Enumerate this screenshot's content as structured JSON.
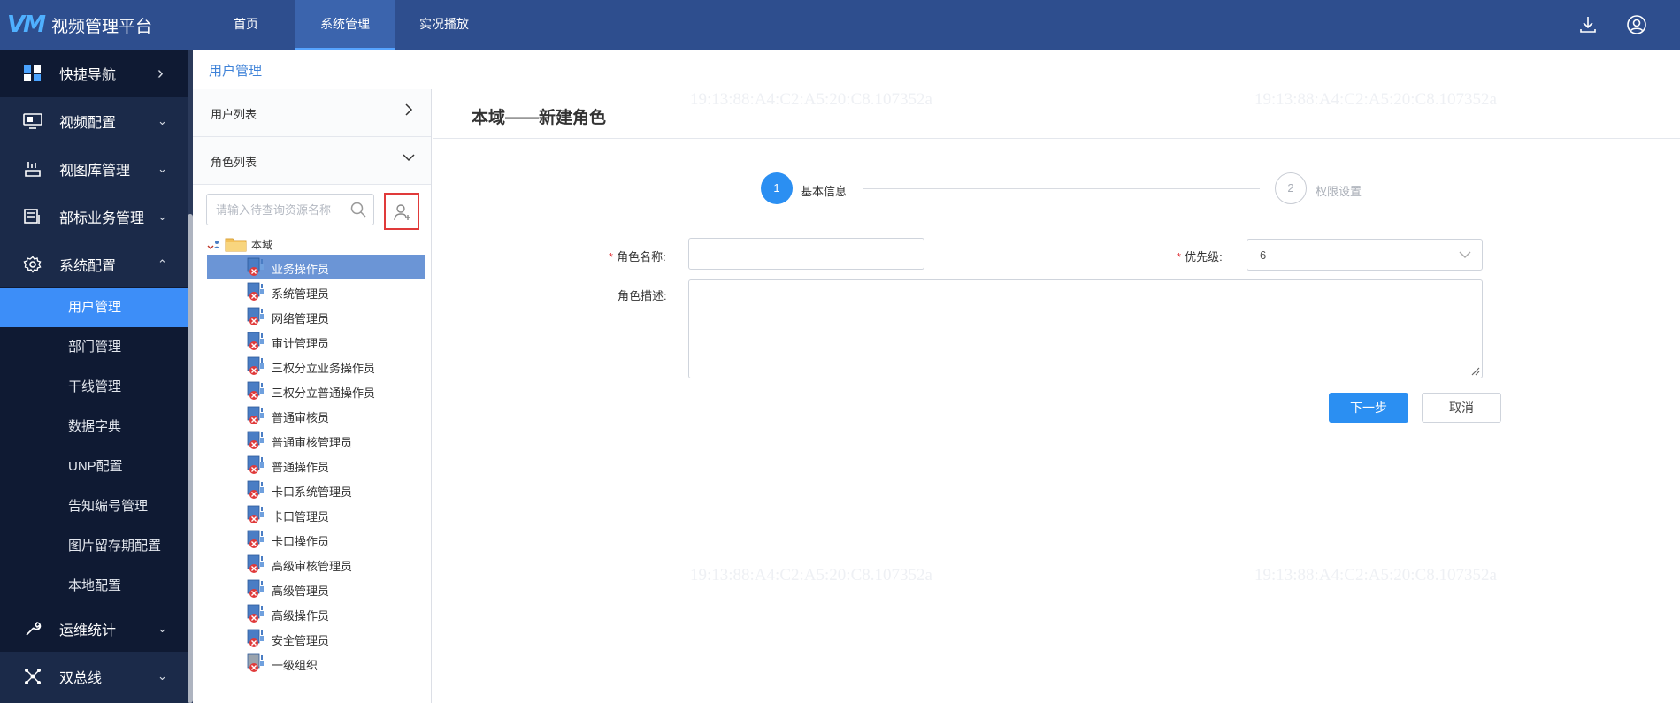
{
  "app": {
    "logo_mark": "VM",
    "title": "视频管理平台"
  },
  "topnav": [
    {
      "label": "首页",
      "active": false
    },
    {
      "label": "系统管理",
      "active": true
    },
    {
      "label": "实况播放",
      "active": false
    }
  ],
  "topbar_icons": [
    "download-icon",
    "user-account-icon"
  ],
  "sidebar": {
    "groups": [
      {
        "label": "快捷导航",
        "icon": "grid-icon",
        "arrow": "›"
      },
      {
        "label": "视频配置",
        "icon": "monitor-icon",
        "arrow": "⌄"
      },
      {
        "label": "视图库管理",
        "icon": "database-icon",
        "arrow": "⌄"
      },
      {
        "label": "部标业务管理",
        "icon": "server-icon",
        "arrow": "⌄"
      },
      {
        "label": "系统配置",
        "icon": "gear-icon",
        "arrow": "⌃"
      },
      {
        "label": "运维统计",
        "icon": "wrench-icon",
        "arrow": "⌄"
      },
      {
        "label": "双总线",
        "icon": "network-icon",
        "arrow": "⌄"
      }
    ],
    "sub_items": [
      {
        "label": "用户管理",
        "active": true
      },
      {
        "label": "部门管理",
        "active": false
      },
      {
        "label": "干线管理",
        "active": false
      },
      {
        "label": "数据字典",
        "active": false
      },
      {
        "label": "UNP配置",
        "active": false
      },
      {
        "label": "告知编号管理",
        "active": false
      },
      {
        "label": "图片留存期配置",
        "active": false
      },
      {
        "label": "本地配置",
        "active": false
      }
    ]
  },
  "breadcrumb": "用户管理",
  "left_panel": {
    "user_list": "用户列表",
    "role_list": "角色列表",
    "search_placeholder": "请输入待查询资源名称",
    "tree_root": "本域",
    "roles": [
      "业务操作员",
      "系统管理员",
      "网络管理员",
      "审计管理员",
      "三权分立业务操作员",
      "三权分立普通操作员",
      "普通审核员",
      "普通审核管理员",
      "普通操作员",
      "卡口系统管理员",
      "卡口管理员",
      "卡口操作员",
      "高级审核管理员",
      "高级管理员",
      "高级操作员",
      "安全管理员",
      "一级组织"
    ],
    "selected_index": 0
  },
  "content": {
    "title": "本域——新建角色",
    "steps": [
      {
        "number": "1",
        "label": "基本信息",
        "active": true
      },
      {
        "number": "2",
        "label": "权限设置",
        "active": false
      }
    ],
    "form": {
      "role_name_label": "角色名称:",
      "role_name_value": "",
      "priority_label": "优先级:",
      "priority_value": "6",
      "description_label": "角色描述:",
      "description_value": ""
    },
    "next_button": "下一步",
    "cancel_button": "取消"
  },
  "watermark": "19:13:88:A4:C2:A5:20:C8.107352a",
  "colors": {
    "topbar": "#2e4e8e",
    "sidebar": "#1b2a49",
    "accent": "#2b8ff2",
    "selected_tree": "#6b95d6",
    "required": "#e2393f"
  }
}
